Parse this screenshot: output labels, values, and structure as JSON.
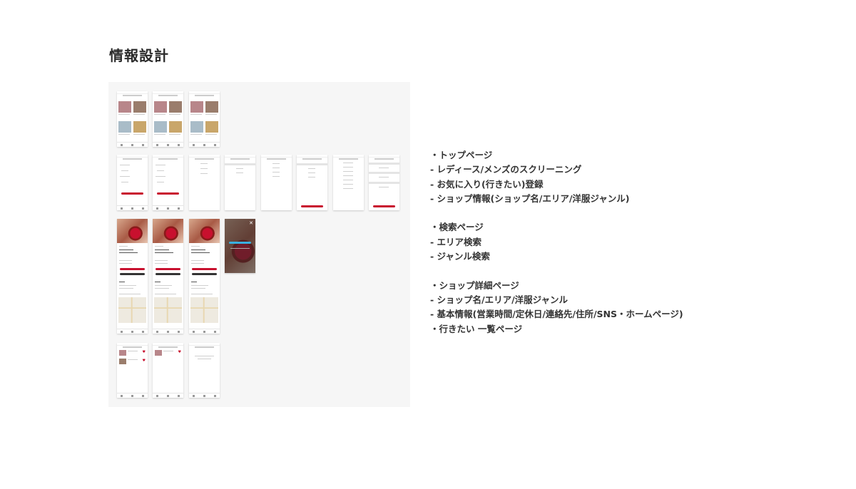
{
  "page": {
    "title": "情報設計"
  },
  "wireframes": {
    "label": "wireframe-board",
    "accent_red": "#c8102e",
    "accent_blue": "#3ab0e0"
  },
  "notes": {
    "top_heading": "・トップページ",
    "top_items": [
      "- レディース/メンズのスクリーニング",
      "- お気に入り(行きたい)登録",
      "- ショップ情報(ショップ名/エリア/洋服ジャンル)"
    ],
    "search_heading": "・検索ページ",
    "search_items": [
      "- エリア検索",
      "- ジャンル検索"
    ],
    "detail_heading": "・ショップ詳細ページ",
    "detail_items": [
      "- ショップ名/エリア/洋服ジャンル",
      "- 基本情報(営業時間/定休日/連絡先/住所/SNS・ホームページ)"
    ],
    "wishlist_heading": "・行きたい 一覧ページ"
  }
}
